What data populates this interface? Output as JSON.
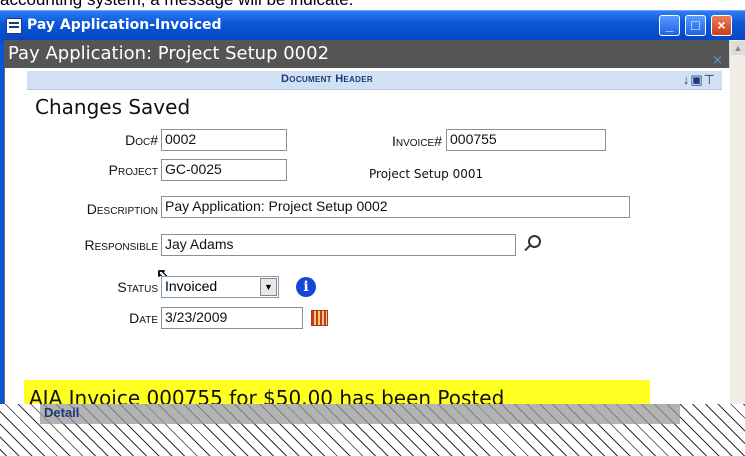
{
  "doc_text": "accounting system, a message will be indicate.",
  "window": {
    "title": "Pay Application-Invoiced",
    "buttons": {
      "minimize": "_",
      "maximize": "□",
      "close": "×"
    }
  },
  "page": {
    "header": "Pay Application: Project Setup 0002",
    "close_glyph": "×"
  },
  "form": {
    "section_header": "Document Header",
    "status_message": "Changes Saved",
    "fields": {
      "doc": {
        "label": "Doc#",
        "value": "0002"
      },
      "invoice": {
        "label": "Invoice#",
        "value": "000755"
      },
      "project": {
        "label": "Project",
        "value": "GC-0025",
        "note": "Project Setup 0001"
      },
      "description": {
        "label": "Description",
        "value": "Pay Application: Project Setup 0002"
      },
      "responsible": {
        "label": "Responsible",
        "value": "Jay Adams"
      },
      "status": {
        "label": "Status",
        "value": "Invoiced"
      },
      "date": {
        "label": "Date",
        "value": "3/23/2009"
      }
    },
    "icons": [
      "arrow-down-icon",
      "save-icon",
      "pin-icon",
      "search-icon",
      "info-icon",
      "calendar-icon"
    ]
  },
  "posted_message": "AIA Invoice 000755 for $50.00 has been Posted",
  "bottom_tab_label": "Detail"
}
